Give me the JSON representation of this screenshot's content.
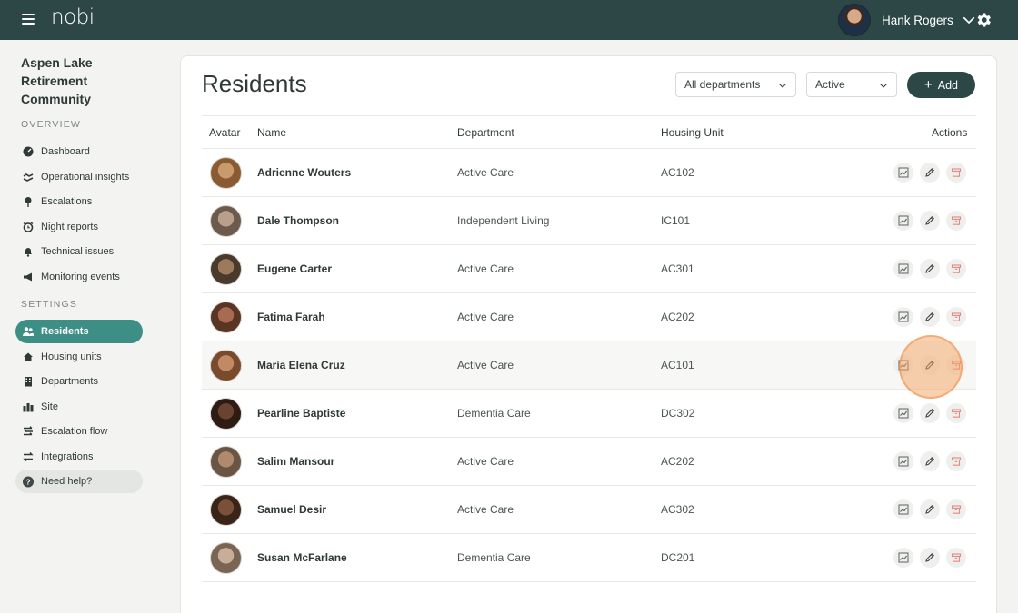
{
  "app": {
    "logo": "nobi"
  },
  "user": {
    "name": "Hank Rogers"
  },
  "sidebar": {
    "community": "Aspen Lake Retirement Community",
    "overview_label": "OVERVIEW",
    "settings_label": "SETTINGS",
    "overview_items": [
      {
        "label": "Dashboard",
        "icon": "dashboard-icon"
      },
      {
        "label": "Operational insights",
        "icon": "handshake-icon"
      },
      {
        "label": "Escalations",
        "icon": "pin-icon"
      },
      {
        "label": "Night reports",
        "icon": "alarm-icon"
      },
      {
        "label": "Technical issues",
        "icon": "bell-icon"
      },
      {
        "label": "Monitoring events",
        "icon": "megaphone-icon"
      }
    ],
    "settings_items": [
      {
        "label": "Residents",
        "icon": "people-icon",
        "active": true
      },
      {
        "label": "Housing units",
        "icon": "house-icon"
      },
      {
        "label": "Departments",
        "icon": "building-icon"
      },
      {
        "label": "Site",
        "icon": "city-icon"
      },
      {
        "label": "Escalation flow",
        "icon": "flow-icon"
      },
      {
        "label": "Integrations",
        "icon": "arrows-icon"
      }
    ],
    "help": "Need help?"
  },
  "page": {
    "title": "Residents",
    "department_filter": "All departments",
    "status_filter": "Active",
    "add_label": "Add"
  },
  "table": {
    "headers": {
      "avatar": "Avatar",
      "name": "Name",
      "department": "Department",
      "unit": "Housing Unit",
      "actions": "Actions"
    },
    "rows": [
      {
        "name": "Adrienne Wouters",
        "department": "Active Care",
        "unit": "AC102"
      },
      {
        "name": "Dale Thompson",
        "department": "Independent Living",
        "unit": "IC101"
      },
      {
        "name": "Eugene Carter",
        "department": "Active Care",
        "unit": "AC301"
      },
      {
        "name": "Fatima Farah",
        "department": "Active Care",
        "unit": "AC202"
      },
      {
        "name": "María Elena Cruz",
        "department": "Active Care",
        "unit": "AC101"
      },
      {
        "name": "Pearline Baptiste",
        "department": "Dementia Care",
        "unit": "DC302"
      },
      {
        "name": "Salim Mansour",
        "department": "Active Care",
        "unit": "AC202"
      },
      {
        "name": "Samuel Desir",
        "department": "Active Care",
        "unit": "AC302"
      },
      {
        "name": "Susan McFarlane",
        "department": "Dementia Care",
        "unit": "DC201"
      }
    ]
  },
  "colors": {
    "topbar": "#2d4746",
    "accent": "#3d8f85",
    "archive": "#e08a80"
  }
}
